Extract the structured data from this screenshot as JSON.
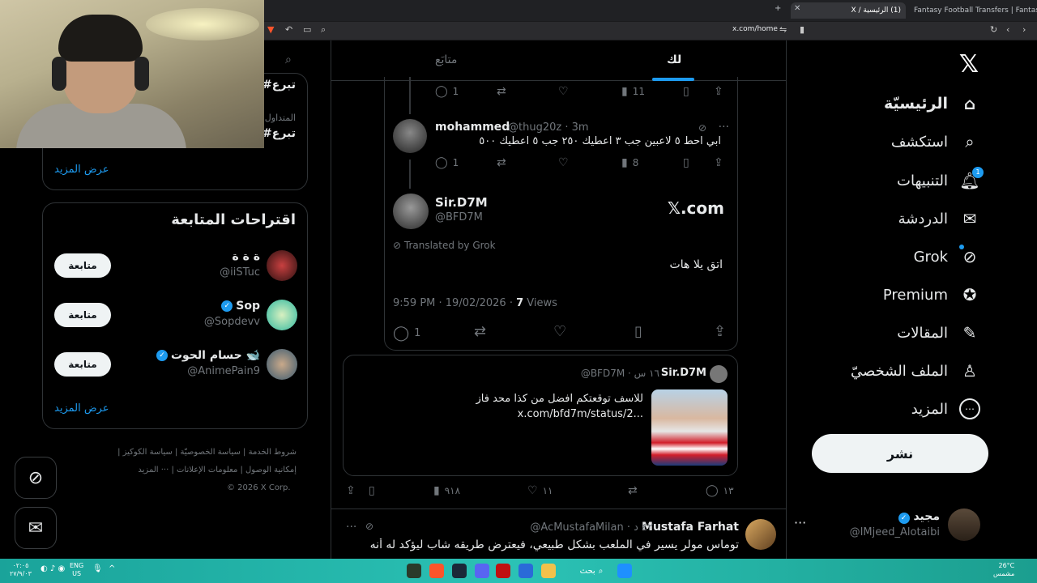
{
  "browser": {
    "tabs": [
      {
        "title": "Fantasy Football Transfers | Fantasy P..."
      },
      {
        "title": "(1) الرئيسية / X"
      }
    ],
    "url": "x.com/home"
  },
  "nav": {
    "items": [
      {
        "label": "الرئيسيّة",
        "icon": "home-icon",
        "glyph": "⌂"
      },
      {
        "label": "استكشف",
        "icon": "search-icon",
        "glyph": "⌕"
      },
      {
        "label": "التنبيهات",
        "icon": "bell-icon",
        "glyph": "♪"
      },
      {
        "label": "الدردشة",
        "icon": "mail-icon",
        "glyph": "✉"
      },
      {
        "label": "Grok",
        "icon": "grok-icon",
        "glyph": "⊘"
      },
      {
        "label": "Premium",
        "icon": "premium-icon",
        "glyph": "✪"
      },
      {
        "label": "المقالات",
        "icon": "articles-icon",
        "glyph": "✎"
      },
      {
        "label": "الملف الشخصيّ",
        "icon": "profile-icon",
        "glyph": "♙"
      },
      {
        "label": "المزيد",
        "icon": "more-icon",
        "glyph": "⋯"
      }
    ],
    "notification_count": "1",
    "post_label": "نشر",
    "account": {
      "name": "مجيد",
      "handle": "@IMjeed_Alotaibi"
    }
  },
  "feed": {
    "tabs": {
      "for_you": "لك",
      "following": "متابَع"
    },
    "reply1_actions": {
      "replies": "1",
      "views": "11"
    },
    "reply2": {
      "name": "mohammed",
      "handle": "@thug20z · 3m",
      "text": "ابي احط ٥ لاعبين  جب ٣ اعطيك ٢٥٠ جب ٥ اعطيك ٥٠٠",
      "replies": "1",
      "views": "8"
    },
    "main": {
      "name": "Sir.D7M",
      "handle": "@BFD7M",
      "logo": "𝕏.com",
      "translated": "Translated by Grok",
      "text": "اتق يلا هات",
      "time": "9:59 PM · 19/02/2026 · ",
      "views_count": "7",
      "views_label": " Views",
      "replies": "1"
    },
    "tweet": {
      "name": "Sir.D7M",
      "handle": "@BFD7M · ١٦ س",
      "text_line1": "للاسف توقعتكم افضل من كذا محد فاز",
      "text_line2": "x.com/bfd7m/status/2...",
      "replies": "١٣",
      "likes": "١١",
      "views": "٩١٨"
    },
    "next": {
      "name": "Mustafa Farhat",
      "handle": "@AcMustafaMilan · ٤٢ د",
      "text": "توماس مولر يسير في الملعب بشكل طبيعي، فيعترض طريقه شاب ليؤكد له أنه"
    }
  },
  "sidebar": {
    "trends": [
      {
        "tag": "#تبرع",
        "category": ""
      },
      {
        "tag": "#تبرع",
        "category": "المتداول"
      }
    ],
    "show_more": "عرض المزيد",
    "follow_title": "اقتراحات المتابعة",
    "follow_users": [
      {
        "name": "ة ة ة",
        "handle": "@iiSTuc",
        "verified": false,
        "button": "متابعة"
      },
      {
        "name": "Sop",
        "handle": "@Sopdevv",
        "verified": true,
        "button": "متابعة"
      },
      {
        "name": "حسام الحوت 🐋",
        "handle": "@AnimePain9",
        "verified": true,
        "button": "متابعة"
      }
    ],
    "show_more2": "عرض المزيد",
    "footer": {
      "line1": "شروط الخدمة | سياسة الخصوصيّة | سياسة الكوكيز |",
      "line2": "إمكانية الوصول | معلومات الإعلانات | ··· المزيد",
      "line3": "© 2026 X Corp."
    }
  },
  "taskbar": {
    "weather": "26°C",
    "weather_desc": "مشمس",
    "search": "بحث",
    "lang": "ENG",
    "region": "US",
    "time": "٠٢:٠٥",
    "date": "٢٧/٩/٠٣"
  },
  "colors": {
    "accent": "#1d9bf0",
    "bg": "#000000",
    "taskbar": "#1aa39a"
  }
}
